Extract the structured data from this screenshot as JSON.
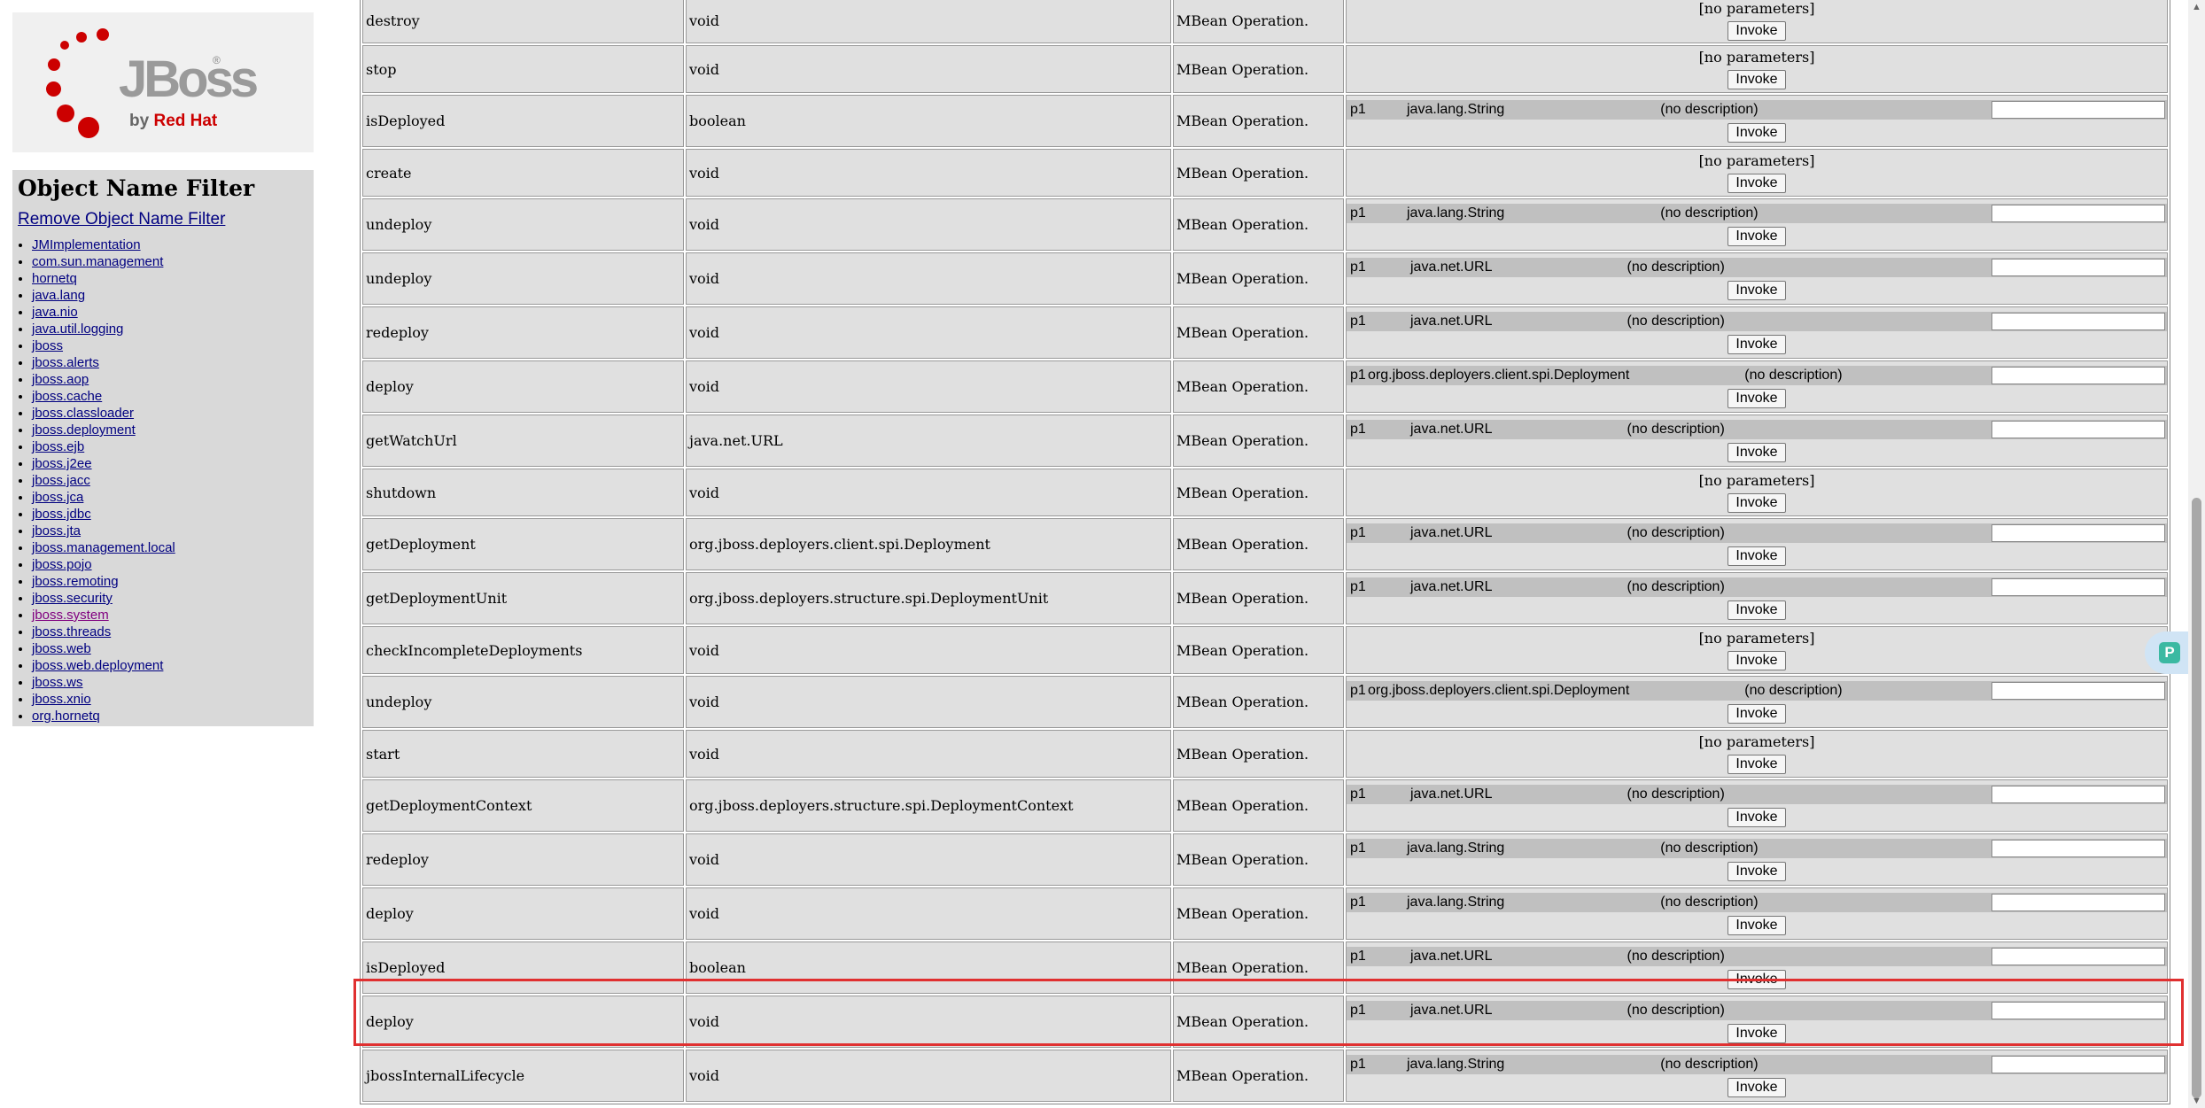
{
  "logo": {
    "brand": "JBoss",
    "registered": "®",
    "by_prefix": "by",
    "by_company": "Red Hat"
  },
  "filter": {
    "title": "Object Name Filter",
    "remove_label": "Remove Object Name Filter",
    "domains": [
      "JMImplementation",
      "com.sun.management",
      "hornetq",
      "java.lang",
      "java.nio",
      "java.util.logging",
      "jboss",
      "jboss.alerts",
      "jboss.aop",
      "jboss.cache",
      "jboss.classloader",
      "jboss.deployment",
      "jboss.ejb",
      "jboss.j2ee",
      "jboss.jacc",
      "jboss.jca",
      "jboss.jdbc",
      "jboss.jta",
      "jboss.management.local",
      "jboss.pojo",
      "jboss.remoting",
      "jboss.security",
      "jboss.system",
      "jboss.threads",
      "jboss.web",
      "jboss.web.deployment",
      "jboss.ws",
      "jboss.xnio",
      "org.hornetq"
    ],
    "visited_domain": "jboss.system"
  },
  "operations": {
    "invoke_label": "Invoke",
    "no_params_label": "[no parameters]",
    "rows": [
      {
        "name": "destroy",
        "return": "void",
        "desc": "MBean Operation.",
        "params": []
      },
      {
        "name": "stop",
        "return": "void",
        "desc": "MBean Operation.",
        "params": []
      },
      {
        "name": "isDeployed",
        "return": "boolean",
        "desc": "MBean Operation.",
        "params": [
          {
            "name": "p1",
            "type": "java.lang.String",
            "desc": "(no description)"
          }
        ]
      },
      {
        "name": "create",
        "return": "void",
        "desc": "MBean Operation.",
        "params": []
      },
      {
        "name": "undeploy",
        "return": "void",
        "desc": "MBean Operation.",
        "params": [
          {
            "name": "p1",
            "type": "java.lang.String",
            "desc": "(no description)"
          }
        ]
      },
      {
        "name": "undeploy",
        "return": "void",
        "desc": "MBean Operation.",
        "params": [
          {
            "name": "p1",
            "type": "java.net.URL",
            "desc": "(no description)"
          }
        ]
      },
      {
        "name": "redeploy",
        "return": "void",
        "desc": "MBean Operation.",
        "params": [
          {
            "name": "p1",
            "type": "java.net.URL",
            "desc": "(no description)"
          }
        ]
      },
      {
        "name": "deploy",
        "return": "void",
        "desc": "MBean Operation.",
        "params": [
          {
            "name": "p1",
            "type": "org.jboss.deployers.client.spi.Deployment",
            "desc": "(no description)"
          }
        ]
      },
      {
        "name": "getWatchUrl",
        "return": "java.net.URL",
        "desc": "MBean Operation.",
        "params": [
          {
            "name": "p1",
            "type": "java.net.URL",
            "desc": "(no description)"
          }
        ]
      },
      {
        "name": "shutdown",
        "return": "void",
        "desc": "MBean Operation.",
        "params": []
      },
      {
        "name": "getDeployment",
        "return": "org.jboss.deployers.client.spi.Deployment",
        "desc": "MBean Operation.",
        "params": [
          {
            "name": "p1",
            "type": "java.net.URL",
            "desc": "(no description)"
          }
        ]
      },
      {
        "name": "getDeploymentUnit",
        "return": "org.jboss.deployers.structure.spi.DeploymentUnit",
        "desc": "MBean Operation.",
        "params": [
          {
            "name": "p1",
            "type": "java.net.URL",
            "desc": "(no description)"
          }
        ]
      },
      {
        "name": "checkIncompleteDeployments",
        "return": "void",
        "desc": "MBean Operation.",
        "params": []
      },
      {
        "name": "undeploy",
        "return": "void",
        "desc": "MBean Operation.",
        "params": [
          {
            "name": "p1",
            "type": "org.jboss.deployers.client.spi.Deployment",
            "desc": "(no description)"
          }
        ]
      },
      {
        "name": "start",
        "return": "void",
        "desc": "MBean Operation.",
        "params": []
      },
      {
        "name": "getDeploymentContext",
        "return": "org.jboss.deployers.structure.spi.DeploymentContext",
        "desc": "MBean Operation.",
        "params": [
          {
            "name": "p1",
            "type": "java.net.URL",
            "desc": "(no description)"
          }
        ]
      },
      {
        "name": "redeploy",
        "return": "void",
        "desc": "MBean Operation.",
        "params": [
          {
            "name": "p1",
            "type": "java.lang.String",
            "desc": "(no description)"
          }
        ]
      },
      {
        "name": "deploy",
        "return": "void",
        "desc": "MBean Operation.",
        "params": [
          {
            "name": "p1",
            "type": "java.lang.String",
            "desc": "(no description)"
          }
        ]
      },
      {
        "name": "isDeployed",
        "return": "boolean",
        "desc": "MBean Operation.",
        "params": [
          {
            "name": "p1",
            "type": "java.net.URL",
            "desc": "(no description)"
          }
        ]
      },
      {
        "name": "deploy",
        "return": "void",
        "desc": "MBean Operation.",
        "params": [
          {
            "name": "p1",
            "type": "java.net.URL",
            "desc": "(no description)"
          }
        ]
      },
      {
        "name": "jbossInternalLifecycle",
        "return": "void",
        "desc": "MBean Operation.",
        "params": [
          {
            "name": "p1",
            "type": "java.lang.String",
            "desc": "(no description)"
          }
        ]
      }
    ]
  },
  "colors": {
    "highlight": "#e03030",
    "op_name": "#800000",
    "link": "#000080",
    "visited": "#800080"
  }
}
